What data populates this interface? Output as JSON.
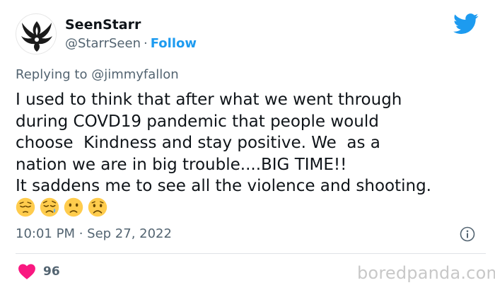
{
  "user": {
    "display_name": "SeenStarr",
    "handle": "@StarrSeen",
    "separator": "·",
    "follow_label": "Follow"
  },
  "reply": {
    "prefix": "Replying to ",
    "mention": "@jimmyfallon"
  },
  "tweet": {
    "lines": [
      "I used to think that after what we went through",
      "during COVD19 pandemic that people would",
      "choose  Kindness and stay positive. We  as a",
      "nation we are in big trouble....BIG TIME!!",
      "It saddens me to see all the violence and shooting."
    ],
    "emojis": [
      "pensive-face",
      "sad-crying-face",
      "slightly-frowning-face",
      "frowning-face"
    ]
  },
  "meta": {
    "timestamp": "10:01 PM · Sep 27, 2022"
  },
  "engagement": {
    "likes": "96"
  },
  "watermark": "boredpanda.com",
  "colors": {
    "accent": "#1d9bf0",
    "heart": "#f91880",
    "secondary_text": "#536471",
    "primary_text": "#0f1419",
    "emoji": "#ffcc4d"
  }
}
